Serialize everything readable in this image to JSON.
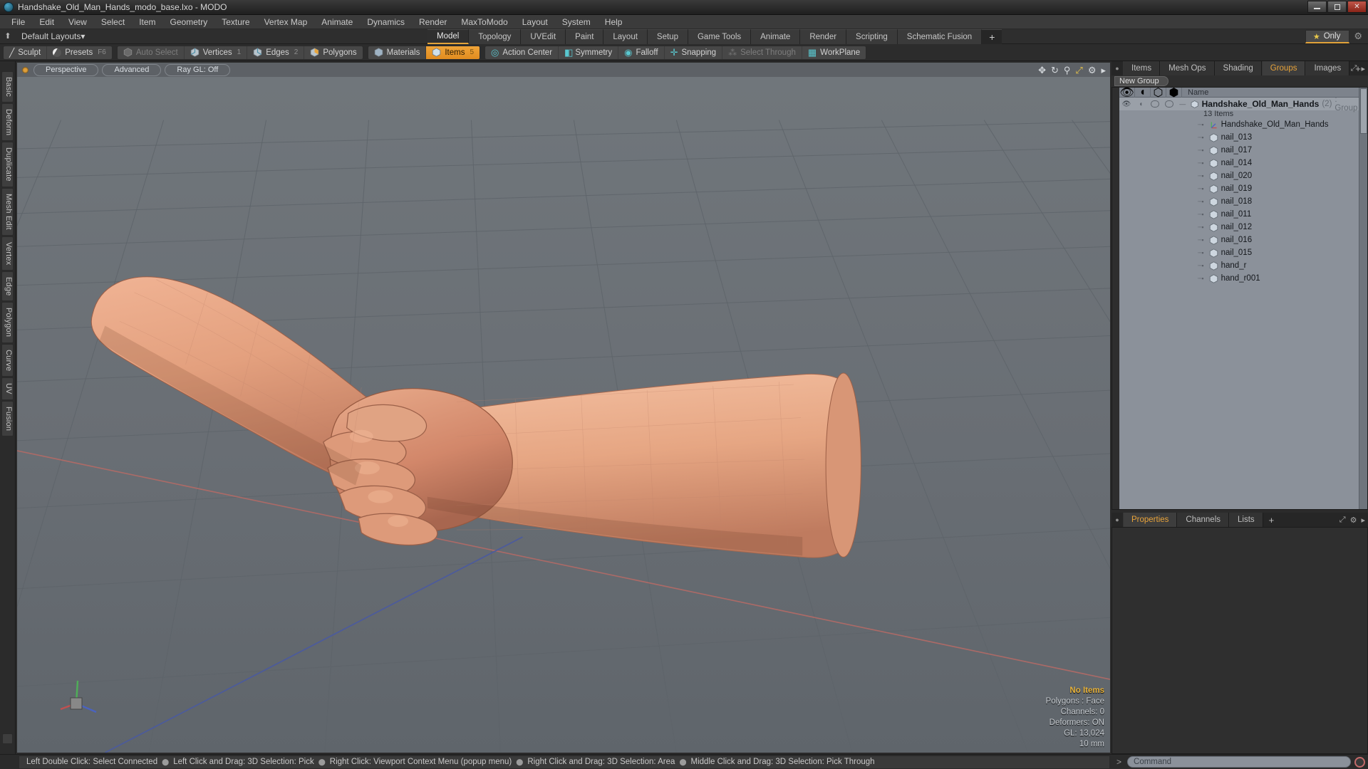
{
  "window": {
    "title": "Handshake_Old_Man_Hands_modo_base.lxo - MODO",
    "minimize": "minimize-icon",
    "maximize": "maximize-icon",
    "close": "close-icon"
  },
  "menubar": {
    "items": [
      "File",
      "Edit",
      "View",
      "Select",
      "Item",
      "Geometry",
      "Texture",
      "Vertex Map",
      "Animate",
      "Dynamics",
      "Render",
      "MaxToModo",
      "Layout",
      "System",
      "Help"
    ]
  },
  "layout_row": {
    "home_icon": "home-icon",
    "dropdown_label": "Default Layouts",
    "dropdown_caret": "▾",
    "tabs": [
      {
        "label": "Model",
        "active": true
      },
      {
        "label": "Topology",
        "active": false
      },
      {
        "label": "UVEdit",
        "active": false
      },
      {
        "label": "Paint",
        "active": false
      },
      {
        "label": "Layout",
        "active": false
      },
      {
        "label": "Setup",
        "active": false
      },
      {
        "label": "Game Tools",
        "active": false
      },
      {
        "label": "Animate",
        "active": false
      },
      {
        "label": "Render",
        "active": false
      },
      {
        "label": "Scripting",
        "active": false
      },
      {
        "label": "Schematic Fusion",
        "active": false
      }
    ],
    "add_tab": "+",
    "only_button": {
      "label": "Only",
      "icon": "star-icon"
    },
    "gear": "gear-icon"
  },
  "modebar": {
    "group1": [
      {
        "label": "Sculpt",
        "icon": "brush-icon",
        "state": "normal",
        "hotkey": ""
      },
      {
        "label": "Presets",
        "icon": "sphere-icon",
        "state": "normal",
        "hotkey": "F6"
      }
    ],
    "group2": [
      {
        "label": "Auto Select",
        "icon": "cube-grey-icon",
        "state": "dim",
        "hotkey": ""
      },
      {
        "label": "Vertices",
        "icon": "cube-vertex-icon",
        "state": "normal",
        "hotkey": "1"
      },
      {
        "label": "Edges",
        "icon": "cube-edge-icon",
        "state": "normal",
        "hotkey": "2"
      },
      {
        "label": "Polygons",
        "icon": "cube-poly-icon",
        "state": "normal",
        "hotkey": ""
      }
    ],
    "group3": [
      {
        "label": "Materials",
        "icon": "cube-material-icon",
        "state": "normal",
        "hotkey": ""
      },
      {
        "label": "Items",
        "icon": "cube-item-icon",
        "state": "active",
        "hotkey": "5"
      }
    ],
    "group4": [
      {
        "label": "Action Center",
        "icon": "action-center-icon",
        "state": "normal",
        "hotkey": ""
      },
      {
        "label": "Symmetry",
        "icon": "symmetry-icon",
        "state": "normal",
        "hotkey": ""
      },
      {
        "label": "Falloff",
        "icon": "falloff-icon",
        "state": "normal",
        "hotkey": ""
      },
      {
        "label": "Snapping",
        "icon": "snapping-icon",
        "state": "normal",
        "hotkey": ""
      },
      {
        "label": "Select Through",
        "icon": "select-through-icon",
        "state": "dim",
        "hotkey": ""
      },
      {
        "label": "WorkPlane",
        "icon": "workplane-icon",
        "state": "normal",
        "hotkey": ""
      }
    ]
  },
  "left_tabs": [
    "Basic",
    "Deform",
    "Duplicate",
    "Mesh Edit",
    "Vertex",
    "Edge",
    "Polygon",
    "Curve",
    "UV",
    "Fusion"
  ],
  "viewport": {
    "dot": "viewport-active-dot",
    "buttons": [
      "Perspective",
      "Advanced",
      "Ray GL: Off"
    ],
    "icons": [
      "pan-icon",
      "rotate-icon",
      "zoom-icon",
      "fit-icon",
      "gear-icon",
      "chevron-right-icon"
    ],
    "stats": {
      "selection": "No Items",
      "polygons": "Polygons : Face",
      "channels": "Channels: 0",
      "deformers": "Deformers: ON",
      "gl": "GL: 13,024",
      "scale": "10 mm"
    },
    "gizmo_axes": [
      "x-axis",
      "y-axis",
      "z-axis"
    ],
    "background_color": "#6a6f74",
    "grid_color": "#5f656a",
    "axis_x_color": "#b05a5a",
    "axis_z_color": "#4a5fa8",
    "model_color": "#e09b7a"
  },
  "right_panel": {
    "tabs": [
      {
        "label": "Items",
        "active": false
      },
      {
        "label": "Mesh Ops",
        "active": false
      },
      {
        "label": "Shading",
        "active": false
      },
      {
        "label": "Groups",
        "active": true
      },
      {
        "label": "Images",
        "active": false
      }
    ],
    "add_tab": "+",
    "header_icons": [
      "expand-icon",
      "chevron-right-icon"
    ],
    "new_group_button": "New Group",
    "tree_columns": [
      "visibility-eye-icon",
      "render-icon",
      "lock-icon",
      "selectable-icon",
      "Name"
    ],
    "group": {
      "name": "Handshake_Old_Man_Hands",
      "count": "(2)",
      "type": ": Group",
      "item_count": "13 Items",
      "icon": "group-cube-icon"
    },
    "items": [
      {
        "name": "Handshake_Old_Man_Hands",
        "icon": "locator-icon"
      },
      {
        "name": "nail_013",
        "icon": "mesh-cube-icon"
      },
      {
        "name": "nail_017",
        "icon": "mesh-cube-icon"
      },
      {
        "name": "nail_014",
        "icon": "mesh-cube-icon"
      },
      {
        "name": "nail_020",
        "icon": "mesh-cube-icon"
      },
      {
        "name": "nail_019",
        "icon": "mesh-cube-icon"
      },
      {
        "name": "nail_018",
        "icon": "mesh-cube-icon"
      },
      {
        "name": "nail_011",
        "icon": "mesh-cube-icon"
      },
      {
        "name": "nail_012",
        "icon": "mesh-cube-icon"
      },
      {
        "name": "nail_016",
        "icon": "mesh-cube-icon"
      },
      {
        "name": "nail_015",
        "icon": "mesh-cube-icon"
      },
      {
        "name": "hand_r",
        "icon": "mesh-cube-icon"
      },
      {
        "name": "hand_r001",
        "icon": "mesh-cube-icon"
      }
    ],
    "bottom_tabs": [
      {
        "label": "Properties",
        "active": true
      },
      {
        "label": "Channels",
        "active": false
      },
      {
        "label": "Lists",
        "active": false
      }
    ],
    "bottom_add_tab": "+"
  },
  "statusbar": {
    "hints": [
      "Left Double Click: Select Connected",
      "Left Click and Drag: 3D Selection: Pick",
      "Right Click: Viewport Context Menu (popup menu)",
      "Right Click and Drag: 3D Selection: Area",
      "Middle Click and Drag: 3D Selection: Pick Through"
    ],
    "command_prompt": ">",
    "command_placeholder": "Command",
    "record_button": "record-icon"
  }
}
